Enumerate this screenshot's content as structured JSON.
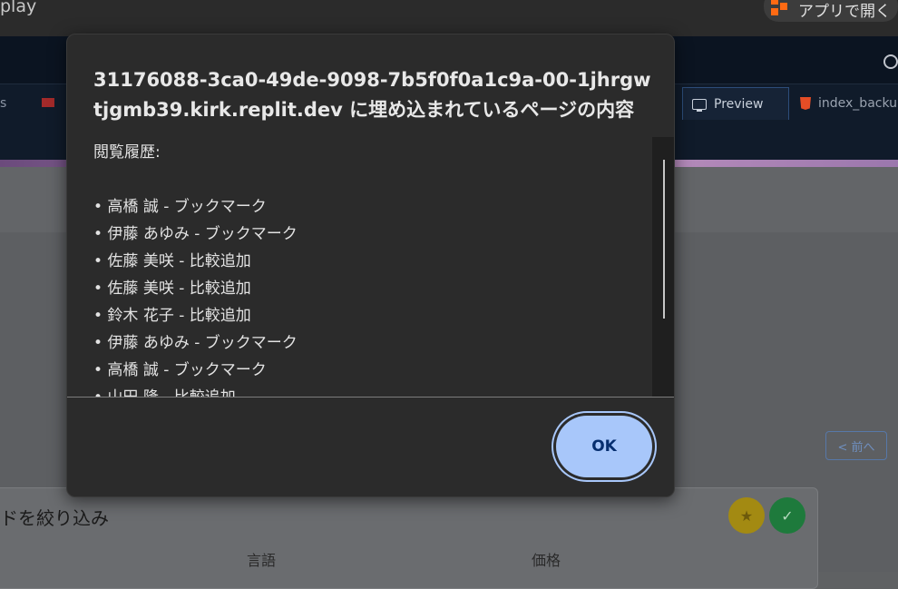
{
  "browser": {
    "window_title_fragment": "play",
    "open_app_label": "アプリで開く"
  },
  "replit": {
    "tabs": [
      {
        "label": "s"
      },
      {
        "label": "Preview"
      },
      {
        "label": "index_backup"
      }
    ]
  },
  "page": {
    "prev_button_label": "< 前へ",
    "filter_title": "ドを絞り込み",
    "columns": [
      "言語",
      "価格"
    ],
    "fab_star_glyph": "★",
    "fab_check_glyph": "✓"
  },
  "dialog": {
    "title": "31176088-3ca0-49de-9098-7b5f0f0a1c9a-00-1jhrgwtjgmb39.kirk.replit.dev に埋め込まれているページの内容",
    "message_heading": "閲覧履歴:",
    "history": [
      "• 高橋 誠 - ブックマーク",
      "• 伊藤 あゆみ - ブックマーク",
      "• 佐藤 美咲 - 比較追加",
      "• 佐藤 美咲 - 比較追加",
      "• 鈴木 花子 - 比較追加",
      "• 伊藤 あゆみ - ブックマーク",
      "• 高橋 誠 - ブックマーク",
      "• 山田 隆 - 比較追加"
    ],
    "ok_label": "OK"
  },
  "colors": {
    "dialog_bg": "#2b2b2b",
    "ok_button": "#a8c7fa",
    "ok_text": "#062e6f",
    "backdrop": "#5f6163"
  }
}
